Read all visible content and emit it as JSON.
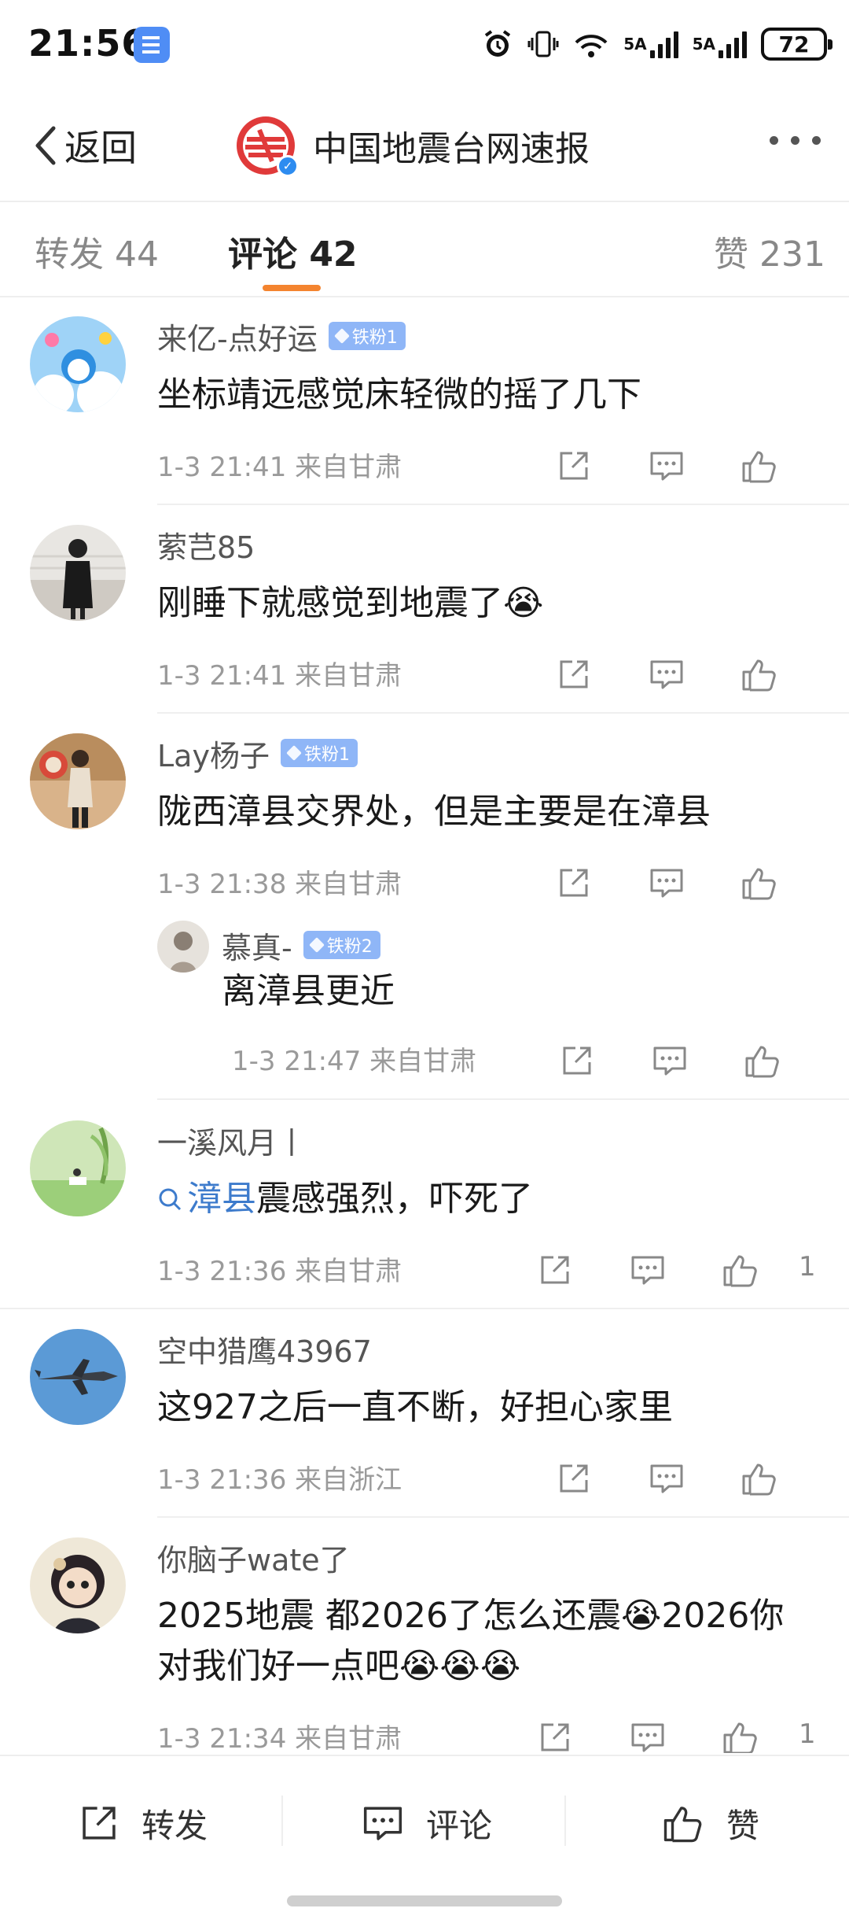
{
  "status_bar": {
    "time": "21:56",
    "signal1": "5A",
    "signal2": "5A",
    "wifi_tag": "7",
    "battery": "72"
  },
  "nav": {
    "back_label": "返回",
    "account_name": "中国地震台网速报"
  },
  "tabs": [
    {
      "label": "转发 44"
    },
    {
      "label": "评论 42"
    },
    {
      "label": "赞 231"
    }
  ],
  "comments": [
    {
      "name": "来亿-点好运",
      "badge": "铁粉1",
      "text": "坐标靖远感觉床轻微的摇了几下",
      "meta": "1-3 21:41 来自甘肃",
      "likes": ""
    },
    {
      "name": "萦芑85",
      "badge": "",
      "text": "刚睡下就感觉到地震了😭",
      "meta": "1-3 21:41 来自甘肃",
      "likes": ""
    },
    {
      "name": "Lay杨子",
      "badge": "铁粉1",
      "text": "陇西漳县交界处，但是主要是在漳县",
      "meta": "1-3 21:38 来自甘肃",
      "likes": ""
    },
    {
      "name": "慕真-",
      "badge": "铁粉2",
      "text": "离漳县更近",
      "meta": "1-3 21:47 来自甘肃",
      "likes": ""
    },
    {
      "name": "一溪风月丨",
      "badge": "",
      "text_link": "漳县",
      "text": "震感强烈，吓死了",
      "meta": "1-3 21:36 来自甘肃",
      "likes": "1"
    },
    {
      "name": "空中猎鹰43967",
      "badge": "",
      "text": "这927之后一直不断，好担心家里",
      "meta": "1-3 21:36 来自浙江",
      "likes": ""
    },
    {
      "name": "你脑子wate了",
      "badge": "",
      "text_line1": "2025地震 都2026了怎么还震😭2026你",
      "text_line2": "对我们好一点吧😭😭😭",
      "meta": "1-3 21:34 来自甘肃",
      "likes": "1"
    }
  ],
  "bottom_bar": {
    "repost": "转发",
    "comment": "评论",
    "like": "赞"
  },
  "colors": {
    "accent": "#f4842f",
    "link": "#3d7bcc",
    "badge": "#8fb6f7"
  }
}
